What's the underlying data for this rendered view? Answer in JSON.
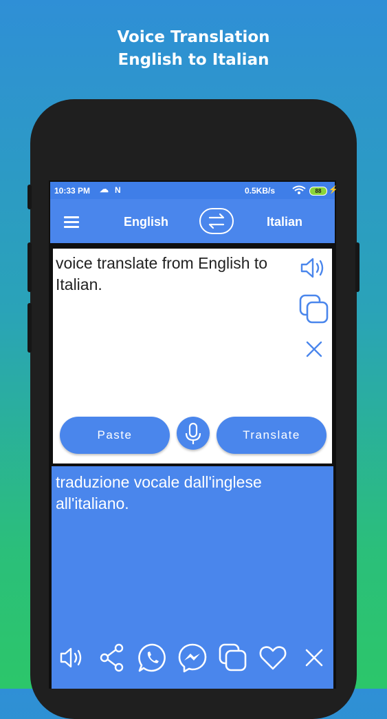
{
  "promo": {
    "line1": "Voice Translation",
    "line2": "English to Italian"
  },
  "status_bar": {
    "time": "10:33 PM",
    "speed": "0.5KB/s",
    "battery": "88",
    "notif_letter": "N"
  },
  "app_bar": {
    "source_lang": "English",
    "target_lang": "Italian",
    "icons": [
      "menu-icon",
      "swap-icon"
    ]
  },
  "input": {
    "text": "voice translate from English to Italian.",
    "side_icons": [
      "speaker-icon",
      "copy-icon",
      "close-icon"
    ],
    "paste_label": "Paste",
    "translate_label": "Translate"
  },
  "output": {
    "text": "traduzione vocale dall'inglese all'italiano.",
    "action_icons": [
      "speaker-icon",
      "share-icon",
      "whatsapp-icon",
      "messenger-icon",
      "copy-icon",
      "heart-icon",
      "close-icon"
    ]
  },
  "colors": {
    "accent": "#4a86ec",
    "phone": "#1f1f1f",
    "card": "#ffffff"
  }
}
